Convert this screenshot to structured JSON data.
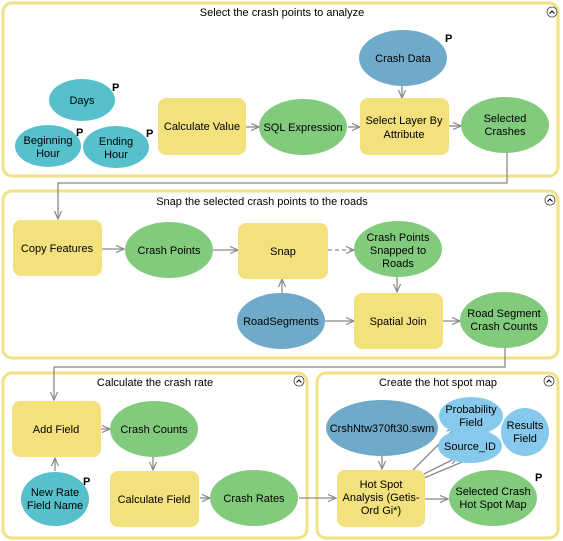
{
  "groups": [
    {
      "title": "Select the crash points to analyze"
    },
    {
      "title": "Snap the selected crash points to the roads"
    },
    {
      "title": "Calculate the crash rate"
    },
    {
      "title": "Create the hot spot map"
    }
  ],
  "collapse_icon": "⌃",
  "parameter_marker": "P",
  "nodes": {
    "days": {
      "line1": "Days",
      "type": "variable",
      "parameter": true
    },
    "beginning_hour": {
      "line1": "Beginning",
      "line2": "Hour",
      "type": "variable",
      "parameter": true
    },
    "ending_hour": {
      "line1": "Ending",
      "line2": "Hour",
      "type": "variable",
      "parameter": true
    },
    "calculate_value": {
      "line1": "Calculate Value",
      "type": "tool"
    },
    "sql_expression": {
      "line1": "SQL Expression",
      "type": "derived"
    },
    "crash_data": {
      "line1": "Crash Data",
      "type": "input-data",
      "parameter": true
    },
    "select_layer": {
      "line1": "Select Layer By",
      "line2": "Attribute",
      "type": "tool"
    },
    "selected_crashes": {
      "line1": "Selected",
      "line2": "Crashes",
      "type": "derived"
    },
    "copy_features": {
      "line1": "Copy Features",
      "type": "tool"
    },
    "crash_points": {
      "line1": "Crash Points",
      "type": "derived"
    },
    "snap": {
      "line1": "Snap",
      "type": "tool"
    },
    "crash_points_snapped": {
      "line1": "Crash Points",
      "line2": "Snapped to",
      "line3": "Roads",
      "type": "derived"
    },
    "road_segments": {
      "line1": "RoadSegments",
      "type": "input-data"
    },
    "spatial_join": {
      "line1": "Spatial Join",
      "type": "tool"
    },
    "road_segment_counts": {
      "line1": "Road Segment",
      "line2": "Crash Counts",
      "type": "derived"
    },
    "add_field": {
      "line1": "Add Field",
      "type": "tool"
    },
    "crash_counts": {
      "line1": "Crash Counts",
      "type": "derived"
    },
    "new_rate_field": {
      "line1": "New Rate",
      "line2": "Field Name",
      "type": "variable",
      "parameter": true
    },
    "calculate_field": {
      "line1": "Calculate Field",
      "type": "tool"
    },
    "crash_rates": {
      "line1": "Crash Rates",
      "type": "derived"
    },
    "swm": {
      "line1": "CrshNtw370ft30.swm",
      "type": "input-data"
    },
    "probability_field": {
      "line1": "Probability",
      "line2": "Field",
      "type": "output-field"
    },
    "source_id": {
      "line1": "Source_ID",
      "type": "output-field"
    },
    "results_field": {
      "line1": "Results",
      "line2": "Field",
      "type": "output-field"
    },
    "hot_spot": {
      "line1": "Hot Spot",
      "line2": "Analysis (Getis-",
      "line3": "Ord Gi*)",
      "type": "tool"
    },
    "hot_spot_map": {
      "line1": "Selected Crash",
      "line2": "Hot Spot Map",
      "type": "derived",
      "parameter": true
    }
  },
  "colors": {
    "tool": "#f2e17d",
    "variable": "#56c0cc",
    "input_data": "#6faac9",
    "derived": "#82cb7d",
    "output_field": "#86c9ec",
    "group_border": "#f2e286"
  }
}
